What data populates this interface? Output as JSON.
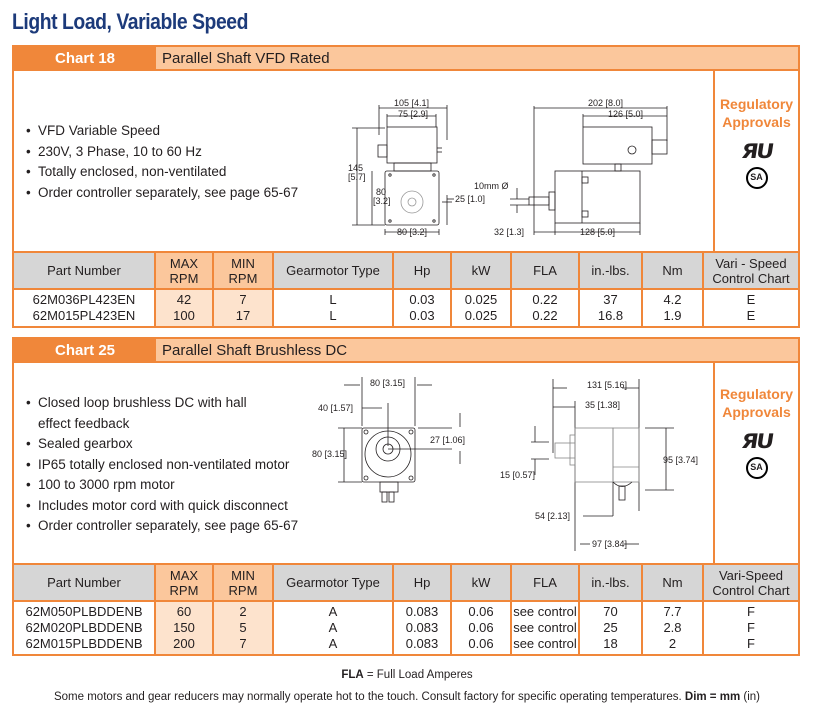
{
  "page": {
    "title": "Light Load, Variable Speed"
  },
  "sections": [
    {
      "chart_label": "Chart 18",
      "chart_name": "Parallel Shaft VFD Rated",
      "bullets": [
        "VFD Variable Speed",
        "230V, 3 Phase, 10 to 60 Hz",
        "Totally enclosed, non-ventilated",
        "Order controller separately, see page 65-67"
      ],
      "diagram_labels": {
        "front_w1": "105 [4.1]",
        "front_w2": "75 [2.9]",
        "front_h1": "145",
        "front_h1b": "[5.7]",
        "front_h2": "80",
        "front_h2b": "[3.2]",
        "front_shaft": "25 [1.0]",
        "front_base": "80 [3.2]",
        "side_total": "202 [8.0]",
        "side_top": "126 [5.0]",
        "side_shaft_dia": "10mm Ø",
        "side_shaft_len": "32 [1.3]",
        "side_body": "128 [5.0]"
      },
      "approvals": {
        "title_line1": "Regulatory",
        "title_line2": "Approvals",
        "ul": "ЯU",
        "csa": "SA"
      },
      "table": {
        "headers": [
          "Part Number",
          "MAX RPM",
          "MIN RPM",
          "Gearmotor Type",
          "Hp",
          "kW",
          "FLA",
          "in.-lbs.",
          "Nm",
          "Vari - Speed Control Chart"
        ],
        "header_lines": [
          [
            "Part Number"
          ],
          [
            "MAX",
            "RPM"
          ],
          [
            "MIN",
            "RPM"
          ],
          [
            "Gearmotor Type"
          ],
          [
            "Hp"
          ],
          [
            "kW"
          ],
          [
            "FLA"
          ],
          [
            "in.-lbs."
          ],
          [
            "Nm"
          ],
          [
            "Vari - Speed",
            "Control Chart"
          ]
        ],
        "rows": [
          [
            "62M036PL423EN",
            "42",
            "7",
            "L",
            "0.03",
            "0.025",
            "0.22",
            "37",
            "4.2",
            "E"
          ],
          [
            "62M015PL423EN",
            "100",
            "17",
            "L",
            "0.03",
            "0.025",
            "0.22",
            "16.8",
            "1.9",
            "E"
          ]
        ]
      }
    },
    {
      "chart_label": "Chart 25",
      "chart_name": "Parallel Shaft Brushless DC",
      "bullets": [
        "Closed loop brushless DC with hall effect feedback",
        "Sealed gearbox",
        "IP65 totally enclosed non-ventilated motor",
        "100 to 3000 rpm motor",
        "Includes motor cord with quick disconnect",
        "Order controller separately, see page 65-67"
      ],
      "bullet_first_line": "Closed loop brushless DC with hall",
      "bullet_first_cont": "effect feedback",
      "diagram_labels": {
        "front_w": "80 [3.15]",
        "front_half": "40 [1.57]",
        "front_h": "80 [3.15]",
        "front_shaft": "27 [1.06]",
        "side_total": "131 [5.16]",
        "side_shaft": "35 [1.38]",
        "side_dia": "15 [0.57]",
        "side_h": "95 [3.74]",
        "side_gear": "54 [2.13]",
        "side_body": "97 [3.84]"
      },
      "approvals": {
        "title_line1": "Regulatory",
        "title_line2": "Approvals",
        "ul": "ЯU",
        "csa": "SA"
      },
      "table": {
        "headers": [
          "Part Number",
          "MAX RPM",
          "MIN RPM",
          "Gearmotor Type",
          "Hp",
          "kW",
          "FLA",
          "in.-lbs.",
          "Nm",
          "Vari-Speed Control Chart"
        ],
        "header_lines": [
          [
            "Part Number"
          ],
          [
            "MAX",
            "RPM"
          ],
          [
            "MIN",
            "RPM"
          ],
          [
            "Gearmotor Type"
          ],
          [
            "Hp"
          ],
          [
            "kW"
          ],
          [
            "FLA"
          ],
          [
            "in.-lbs."
          ],
          [
            "Nm"
          ],
          [
            "Vari-Speed",
            "Control Chart"
          ]
        ],
        "rows": [
          [
            "62M050PLBDDENB",
            "60",
            "2",
            "A",
            "0.083",
            "0.06",
            "see control",
            "70",
            "7.7",
            "F"
          ],
          [
            "62M020PLBDDENB",
            "150",
            "5",
            "A",
            "0.083",
            "0.06",
            "see control",
            "25",
            "2.8",
            "F"
          ],
          [
            "62M015PLBDDENB",
            "200",
            "7",
            "A",
            "0.083",
            "0.06",
            "see control",
            "18",
            "2",
            "F"
          ]
        ]
      }
    }
  ],
  "footer": {
    "fla_bold": "FLA",
    "fla_rest": " = Full Load Amperes",
    "note": "Some motors and gear reducers may normally operate hot to the touch.  Consult factory for specific operating temperatures.  ",
    "dim_bold": "Dim = mm",
    "dim_rest": " (in)"
  }
}
